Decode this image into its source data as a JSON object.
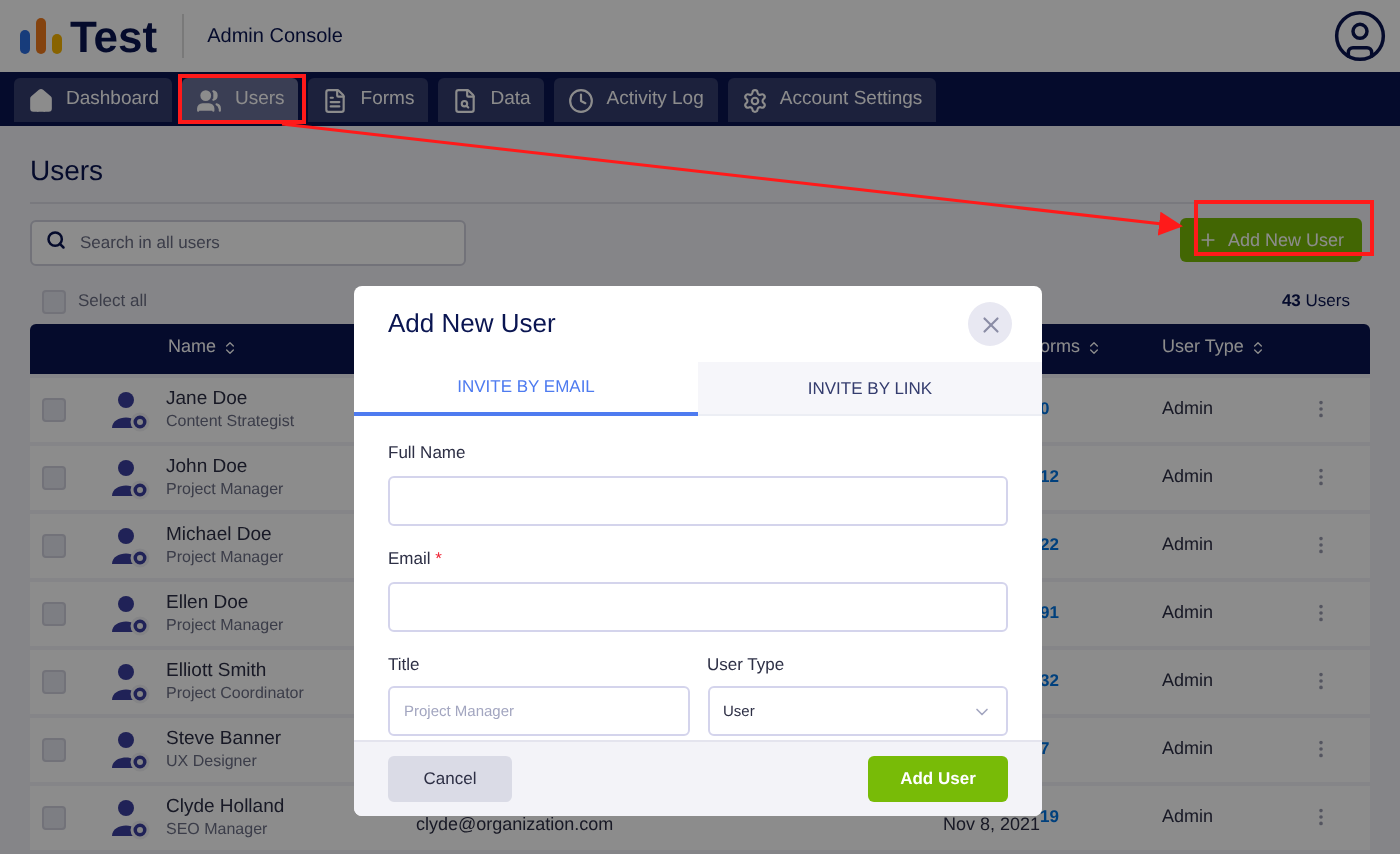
{
  "header": {
    "logo": "Test",
    "subtitle": "Admin Console"
  },
  "nav": [
    {
      "label": "Dashboard",
      "selected": false
    },
    {
      "label": "Users",
      "selected": true
    },
    {
      "label": "Forms",
      "selected": false
    },
    {
      "label": "Data",
      "selected": false
    },
    {
      "label": "Activity Log",
      "selected": false
    },
    {
      "label": "Account Settings",
      "selected": false
    }
  ],
  "page_title": "Users",
  "search": {
    "placeholder": "Search in all users"
  },
  "add_button": "Add New User",
  "select_all": {
    "label": "Select all",
    "checked": false
  },
  "user_count": {
    "number": "43",
    "label": "Users"
  },
  "table": {
    "columns": [
      "Name",
      "orms",
      "User Type"
    ],
    "rows": [
      {
        "name": "Jane Doe",
        "title": "Content Strategist",
        "forms": "0",
        "user_type": "Admin",
        "checked": false
      },
      {
        "name": "John Doe",
        "title": "Project Manager",
        "forms": "12",
        "user_type": "Admin",
        "checked": false
      },
      {
        "name": "Michael Doe",
        "title": "Project Manager",
        "forms": "22",
        "user_type": "Admin",
        "checked": false
      },
      {
        "name": "Ellen Doe",
        "title": "Project Manager",
        "forms": "91",
        "user_type": "Admin",
        "checked": false
      },
      {
        "name": "Elliott Smith",
        "title": "Project Coordinator",
        "forms": "32",
        "user_type": "Admin",
        "checked": false
      },
      {
        "name": "Steve Banner",
        "title": "UX Designer",
        "forms": "7",
        "user_type": "Admin",
        "checked": false
      },
      {
        "name": "Clyde Holland",
        "title": "SEO Manager",
        "email": "clyde@organization.com",
        "date": "Nov 8, 2021",
        "forms": "19",
        "user_type": "Admin",
        "checked": false
      }
    ]
  },
  "modal": {
    "title": "Add New User",
    "tabs": [
      {
        "label": "INVITE BY EMAIL",
        "selected": true
      },
      {
        "label": "INVITE BY LINK",
        "selected": false
      }
    ],
    "full_name": {
      "label": "Full Name"
    },
    "email": {
      "label": "Email",
      "required_mark": "*"
    },
    "title_field": {
      "label": "Title",
      "placeholder": "Project Manager"
    },
    "user_type": {
      "label": "User Type",
      "value": "User"
    },
    "cancel": "Cancel",
    "submit": "Add User"
  }
}
